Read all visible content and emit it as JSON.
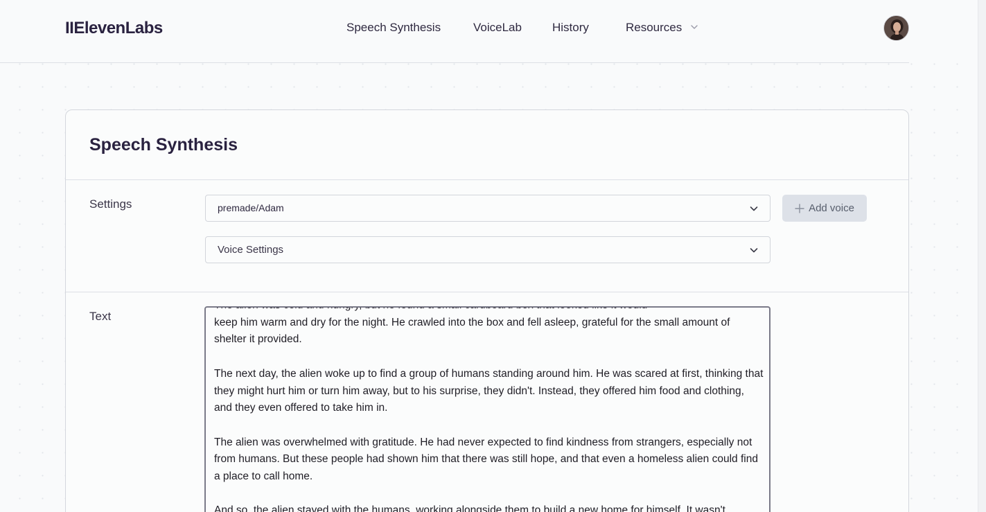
{
  "brand": {
    "logo_text": "IIElevenLabs"
  },
  "nav": {
    "items": [
      {
        "label": "Speech Synthesis"
      },
      {
        "label": "VoiceLab"
      },
      {
        "label": "History"
      },
      {
        "label": "Resources"
      }
    ]
  },
  "page": {
    "title": "Speech Synthesis"
  },
  "settings": {
    "label": "Settings",
    "voice_select": {
      "value": "premade/Adam"
    },
    "voice_settings": {
      "label": "Voice Settings"
    },
    "add_voice_label": "Add voice"
  },
  "text_section": {
    "label": "Text",
    "content": "The alien was cold and hungry, but he found a small cardboard box that looked like it would\nkeep him warm and dry for the night. He crawled into the box and fell asleep, grateful for the small amount of shelter it provided.\n\nThe next day, the alien woke up to find a group of humans standing around him. He was scared at first, thinking that they might hurt him or turn him away, but to his surprise, they didn't. Instead, they offered him food and clothing, and they even offered to take him in.\n\nThe alien was overwhelmed with gratitude. He had never expected to find kindness from strangers, especially not from humans. But these people had shown him that there was still hope, and that even a homeless alien could find a place to call home.\n\nAnd so, the alien stayed with the humans, working alongside them to build a new home for himself. It wasn't"
  },
  "icons": {
    "resources_chevron": "chevron-down-icon",
    "select_chevron": "chevron-down-icon",
    "add": "plus-icon",
    "avatar": "user-avatar"
  }
}
